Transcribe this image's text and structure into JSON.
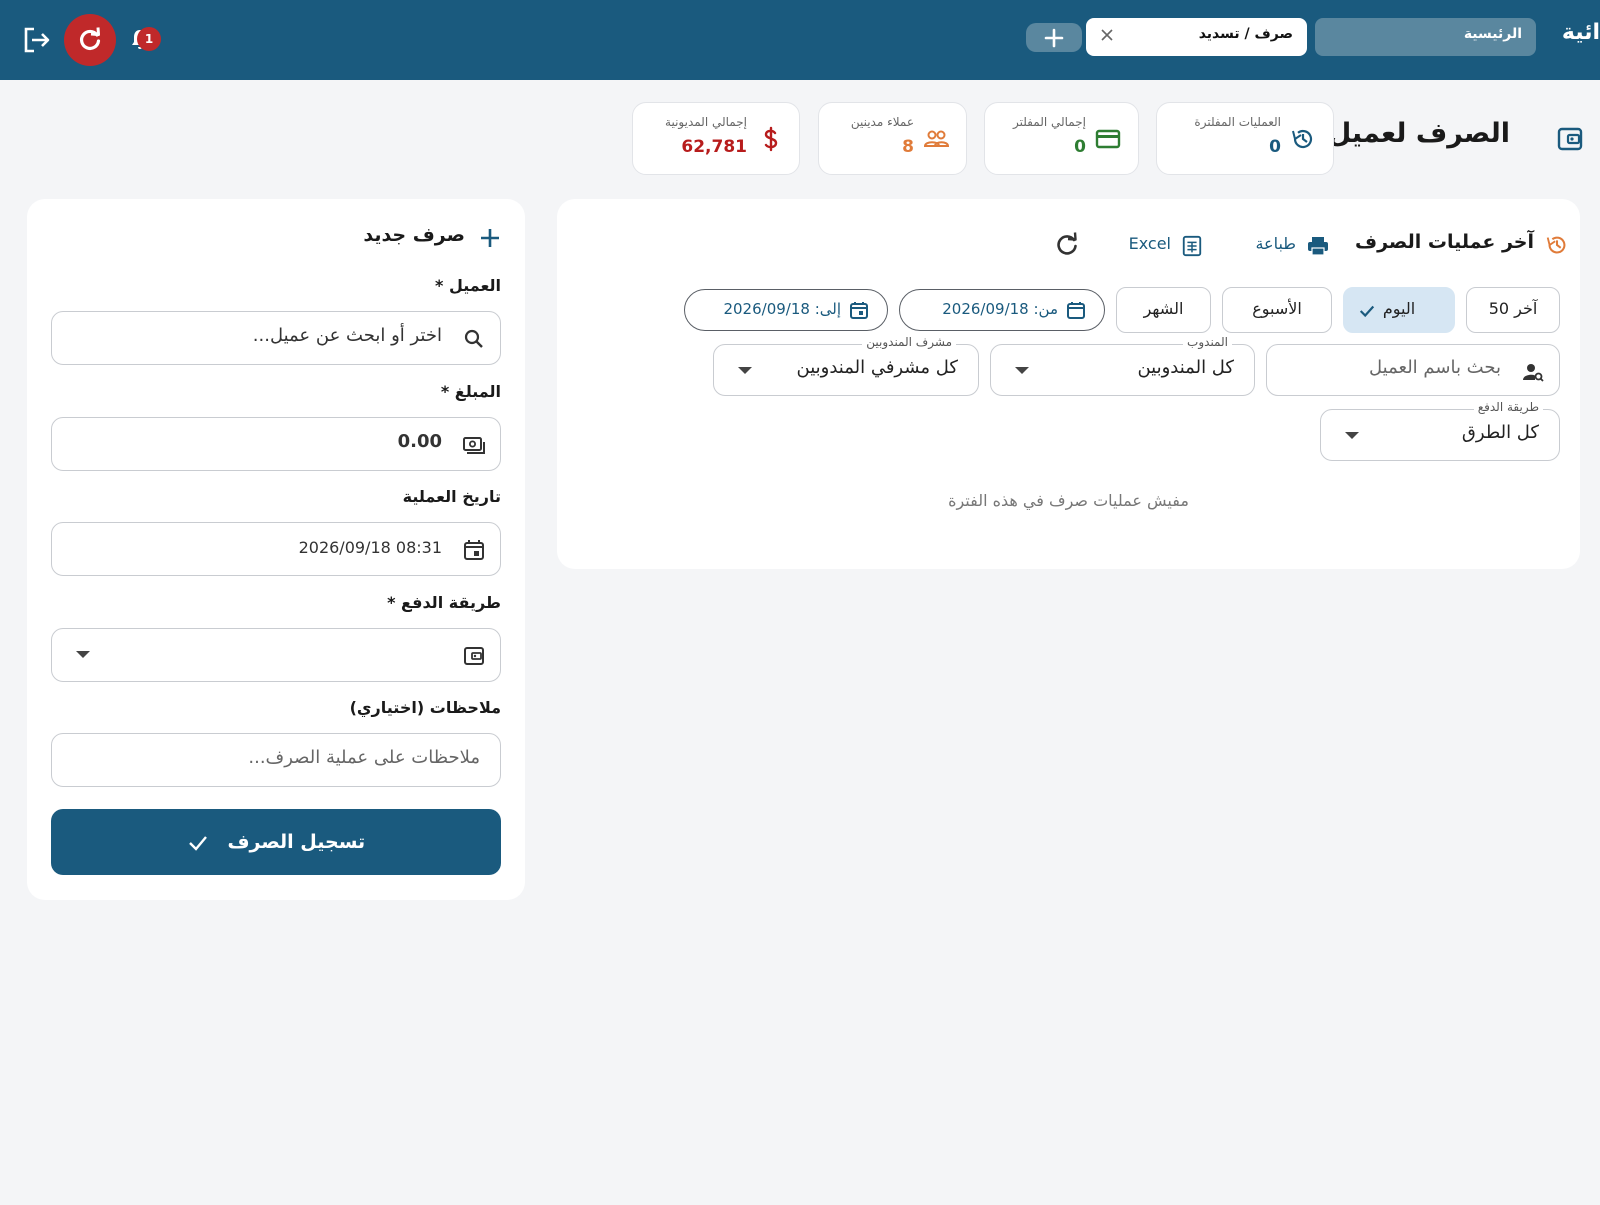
{
  "topbar": {
    "brand": "ائية",
    "tabs": [
      {
        "label": "الرئيسية",
        "active": false
      },
      {
        "label": "صرف / تسديد",
        "active": true
      }
    ],
    "notifications_count": "1"
  },
  "page": {
    "title": "الصرف لعميل"
  },
  "stats": [
    {
      "label": "العمليات المفلترة",
      "value": "0",
      "color": "#1a5a7e",
      "icon": "history-icon"
    },
    {
      "label": "إجمالي المفلتر",
      "value": "0",
      "color": "#2e7d32",
      "icon": "credit-card-icon"
    },
    {
      "label": "عملاء مدينين",
      "value": "8",
      "color": "#e07b39",
      "icon": "group-icon"
    },
    {
      "label": "إجمالي المديونية",
      "value": "62,781",
      "color": "#b71c1c",
      "icon": "dollar-icon"
    }
  ],
  "recent": {
    "title": "آخر عمليات الصرف",
    "print_label": "طباعة",
    "excel_label": "Excel",
    "chips": [
      {
        "label": "آخر 50",
        "active": false
      },
      {
        "label": "اليوم",
        "active": true
      },
      {
        "label": "الأسبوع",
        "active": false
      },
      {
        "label": "الشهر",
        "active": false
      }
    ],
    "from_date": "من: 2026/09/18",
    "to_date": "إلى: 2026/09/18",
    "customer_search_placeholder": "بحث باسم العميل",
    "rep_label": "المندوب",
    "rep_value": "كل المندوبين",
    "supervisor_label": "مشرف المندوبين",
    "supervisor_value": "كل مشرفي المندوبين",
    "payment_label": "طريقة الدفع",
    "payment_value": "كل الطرق",
    "empty_message": "مفيش عمليات صرف في هذه الفترة"
  },
  "form": {
    "title": "صرف جديد",
    "customer_label": "العميل *",
    "customer_placeholder": "اختر أو ابحث عن عميل...",
    "amount_label": "المبلغ *",
    "amount_value": "0.00",
    "date_label": "تاريخ العملية",
    "date_value": "2026/09/18 08:31",
    "payment_label": "طريقة الدفع *",
    "notes_label": "ملاحظات (اختياري)",
    "notes_placeholder": "ملاحظات على عملية الصرف...",
    "submit_label": "تسجيل الصرف"
  },
  "colors": {
    "primary": "#1a5a7e",
    "danger": "#c0292a",
    "chip_active": "#d6e6f3"
  }
}
